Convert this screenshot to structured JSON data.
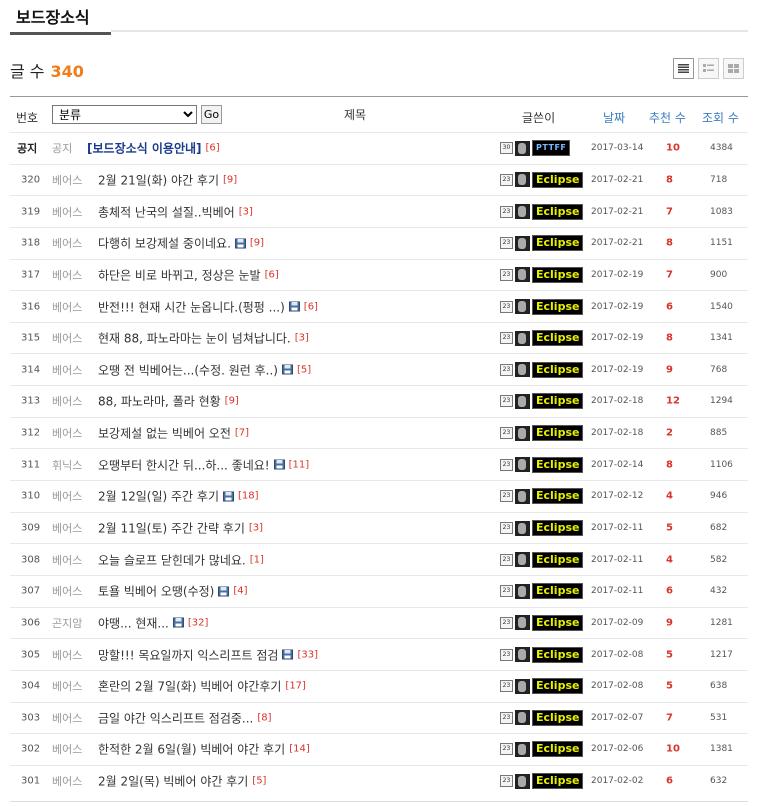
{
  "board": {
    "title": "보드장소식"
  },
  "count": {
    "label": "글 수",
    "value": "340"
  },
  "header": {
    "no": "번호",
    "category_selected": "분류",
    "go": "Go",
    "subject": "제목",
    "writer": "글쓴이",
    "date": "날짜",
    "recommend": "추천 수",
    "views": "조회 수"
  },
  "notice": {
    "no": "공지",
    "cat": "공지",
    "title": "[보드장소식 이용안내]",
    "comments": "[6]",
    "level": "30",
    "nick": "PTTFF",
    "date": "2017-03-14",
    "rec": "10",
    "views": "4384"
  },
  "rows": [
    {
      "no": "320",
      "cat": "베어스",
      "title": "2월 21일(화) 야간 후기",
      "comments": "[9]",
      "file": false,
      "level": "23",
      "nick": "Eclipse",
      "date": "2017-02-21",
      "rec": "8",
      "views": "718"
    },
    {
      "no": "319",
      "cat": "베어스",
      "title": "총체적 난국의 설질..빅베어",
      "comments": "[3]",
      "file": false,
      "level": "23",
      "nick": "Eclipse",
      "date": "2017-02-21",
      "rec": "7",
      "views": "1083"
    },
    {
      "no": "318",
      "cat": "베어스",
      "title": "다행히 보강제설 중이네요.",
      "comments": "[9]",
      "file": true,
      "level": "23",
      "nick": "Eclipse",
      "date": "2017-02-21",
      "rec": "8",
      "views": "1151"
    },
    {
      "no": "317",
      "cat": "베어스",
      "title": "하단은 비로 바뀌고, 정상은 눈발",
      "comments": "[6]",
      "file": false,
      "level": "23",
      "nick": "Eclipse",
      "date": "2017-02-19",
      "rec": "7",
      "views": "900"
    },
    {
      "no": "316",
      "cat": "베어스",
      "title": "반전!!! 현재 시간 눈옵니다.(펑펑 ...)",
      "comments": "[6]",
      "file": true,
      "level": "23",
      "nick": "Eclipse",
      "date": "2017-02-19",
      "rec": "6",
      "views": "1540"
    },
    {
      "no": "315",
      "cat": "베어스",
      "title": "현재 88, 파노라마는 눈이 넘쳐납니다.",
      "comments": "[3]",
      "file": false,
      "level": "23",
      "nick": "Eclipse",
      "date": "2017-02-19",
      "rec": "8",
      "views": "1341"
    },
    {
      "no": "314",
      "cat": "베어스",
      "title": "오땡 전 빅베어는...(수정. 원런 후..)",
      "comments": "[5]",
      "file": true,
      "level": "23",
      "nick": "Eclipse",
      "date": "2017-02-19",
      "rec": "9",
      "views": "768"
    },
    {
      "no": "313",
      "cat": "베어스",
      "title": "88, 파노라마, 폴라 현황",
      "comments": "[9]",
      "file": false,
      "level": "23",
      "nick": "Eclipse",
      "date": "2017-02-18",
      "rec": "12",
      "views": "1294"
    },
    {
      "no": "312",
      "cat": "베어스",
      "title": "보강제설 없는 빅베어 오전",
      "comments": "[7]",
      "file": false,
      "level": "23",
      "nick": "Eclipse",
      "date": "2017-02-18",
      "rec": "2",
      "views": "885"
    },
    {
      "no": "311",
      "cat": "휘닉스",
      "title": "오땡부터 한시간 뒤...하... 좋네요!",
      "comments": "[11]",
      "file": true,
      "level": "23",
      "nick": "Eclipse",
      "date": "2017-02-14",
      "rec": "8",
      "views": "1106"
    },
    {
      "no": "310",
      "cat": "베어스",
      "title": "2월 12일(일) 주간 후기",
      "comments": "[18]",
      "file": true,
      "level": "23",
      "nick": "Eclipse",
      "date": "2017-02-12",
      "rec": "4",
      "views": "946"
    },
    {
      "no": "309",
      "cat": "베어스",
      "title": "2월 11일(토) 주간 간략 후기",
      "comments": "[3]",
      "file": false,
      "level": "23",
      "nick": "Eclipse",
      "date": "2017-02-11",
      "rec": "5",
      "views": "682"
    },
    {
      "no": "308",
      "cat": "베어스",
      "title": "오늘 슬로프 닫힌데가 많네요.",
      "comments": "[1]",
      "file": false,
      "level": "23",
      "nick": "Eclipse",
      "date": "2017-02-11",
      "rec": "4",
      "views": "582"
    },
    {
      "no": "307",
      "cat": "베어스",
      "title": "토욜 빅베어 오땡(수정)",
      "comments": "[4]",
      "file": true,
      "level": "23",
      "nick": "Eclipse",
      "date": "2017-02-11",
      "rec": "6",
      "views": "432"
    },
    {
      "no": "306",
      "cat": "곤지암",
      "title": "야땡... 현재...",
      "comments": "[32]",
      "file": true,
      "level": "23",
      "nick": "Eclipse",
      "date": "2017-02-09",
      "rec": "9",
      "views": "1281"
    },
    {
      "no": "305",
      "cat": "베어스",
      "title": "망할!!! 목요일까지 익스리프트 점검",
      "comments": "[33]",
      "file": true,
      "level": "23",
      "nick": "Eclipse",
      "date": "2017-02-08",
      "rec": "5",
      "views": "1217"
    },
    {
      "no": "304",
      "cat": "베어스",
      "title": "혼란의 2월 7일(화) 빅베어 야간후기",
      "comments": "[17]",
      "file": false,
      "level": "23",
      "nick": "Eclipse",
      "date": "2017-02-08",
      "rec": "5",
      "views": "638"
    },
    {
      "no": "303",
      "cat": "베어스",
      "title": "금일 야간 익스리프트 점검중...",
      "comments": "[8]",
      "file": false,
      "level": "23",
      "nick": "Eclipse",
      "date": "2017-02-07",
      "rec": "7",
      "views": "531"
    },
    {
      "no": "302",
      "cat": "베어스",
      "title": "한적한 2월 6일(월) 빅베어 야간 후기",
      "comments": "[14]",
      "file": false,
      "level": "23",
      "nick": "Eclipse",
      "date": "2017-02-06",
      "rec": "10",
      "views": "1381"
    },
    {
      "no": "301",
      "cat": "베어스",
      "title": "2월 2일(목) 빅베어 야간 후기",
      "comments": "[5]",
      "file": false,
      "level": "23",
      "nick": "Eclipse",
      "date": "2017-02-02",
      "rec": "6",
      "views": "632"
    }
  ]
}
